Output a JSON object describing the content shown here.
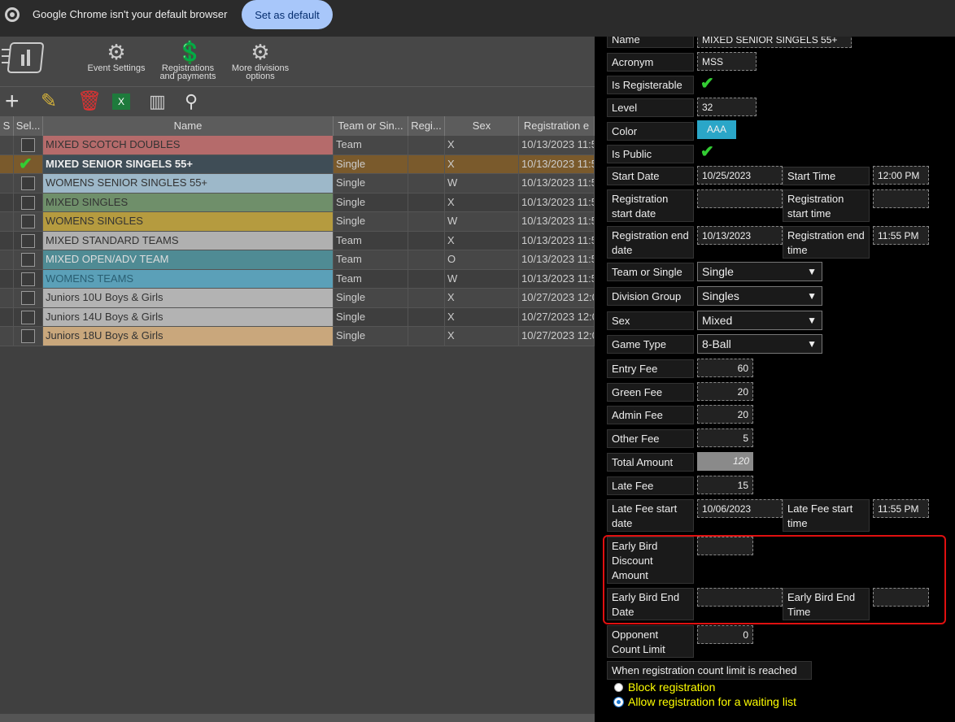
{
  "chrome": {
    "message": "Google Chrome isn't your default browser",
    "button": "Set as default"
  },
  "toolbar": {
    "event_settings": "Event Settings",
    "registrations_l1": "Registrations",
    "registrations_l2": "and payments",
    "more_l1": "More divisions",
    "more_l2": "options"
  },
  "grid": {
    "headers": [
      "Sel...",
      "Name",
      "Team or Sin...",
      "Regi...",
      "Sex",
      "Registration e"
    ],
    "rows": [
      {
        "name": "MIXED SCOTCH DOUBLES",
        "type": "Team",
        "sex": "X",
        "date": "10/13/2023 11:5",
        "color": "#b56b6b",
        "checked": false
      },
      {
        "name": "MIXED SENIOR SINGELS 55+",
        "type": "Single",
        "sex": "X",
        "date": "10/13/2023 11:5",
        "color": "#3f4d56",
        "checked": true
      },
      {
        "name": "WOMENS SENIOR SINGLES 55+",
        "type": "Single",
        "sex": "W",
        "date": "10/13/2023 11:5",
        "color": "#9db8c9",
        "checked": false
      },
      {
        "name": "MIXED SINGLES",
        "type": "Single",
        "sex": "X",
        "date": "10/13/2023 11:5",
        "color": "#6f8f6a",
        "checked": false
      },
      {
        "name": "WOMENS SINGLES",
        "type": "Single",
        "sex": "W",
        "date": "10/13/2023 11:5",
        "color": "#b59b3f",
        "checked": false
      },
      {
        "name": "MIXED STANDARD TEAMS",
        "type": "Team",
        "sex": "X",
        "date": "10/13/2023 11:5",
        "color": "#b0b0b0",
        "checked": false
      },
      {
        "name": "MIXED OPEN/ADV TEAM",
        "type": "Team",
        "sex": "O",
        "date": "10/13/2023 11:5",
        "color": "#4f8b94",
        "checked": false
      },
      {
        "name": "WOMENS TEAMS",
        "type": "Team",
        "sex": "W",
        "date": "10/13/2023 11:5",
        "color": "#5ba0b8",
        "checked": false
      },
      {
        "name": "Juniors 10U Boys & Girls",
        "type": "Single",
        "sex": "X",
        "date": "10/27/2023 12:0",
        "color": "#b3b3b3",
        "checked": false
      },
      {
        "name": "Juniors 14U Boys & Girls",
        "type": "Single",
        "sex": "X",
        "date": "10/27/2023 12:0",
        "color": "#b3b3b3",
        "checked": false
      },
      {
        "name": "Juniors 18U Boys & Girls",
        "type": "Single",
        "sex": "X",
        "date": "10/27/2023 12:0",
        "color": "#c9a77c",
        "checked": false
      }
    ]
  },
  "form": {
    "name_label": "Name",
    "name_value": "MIXED SENIOR SINGELS 55+",
    "acronym_label": "Acronym",
    "acronym_value": "MSS",
    "registerable_label": "Is Registerable",
    "level_label": "Level",
    "level_value": "32",
    "color_label": "Color",
    "color_value": "AAA",
    "public_label": "Is Public",
    "start_date_label": "Start Date",
    "start_date_value": "10/25/2023",
    "start_time_label": "Start Time",
    "start_time_value": "12:00 PM",
    "reg_start_date_label": "Registration start date",
    "reg_start_time_label": "Registration start time",
    "reg_end_date_label": "Registration end date",
    "reg_end_date_value": "10/13/2023",
    "reg_end_time_label": "Registration end time",
    "reg_end_time_value": "11:55 PM",
    "team_single_label": "Team or Single",
    "team_single_value": "Single",
    "division_group_label": "Division Group",
    "division_group_value": "Singles",
    "sex_label": "Sex",
    "sex_value": "Mixed",
    "game_type_label": "Game Type",
    "game_type_value": "8-Ball",
    "entry_fee_label": "Entry Fee",
    "entry_fee_value": "60",
    "green_fee_label": "Green Fee",
    "green_fee_value": "20",
    "admin_fee_label": "Admin Fee",
    "admin_fee_value": "20",
    "other_fee_label": "Other Fee",
    "other_fee_value": "5",
    "total_label": "Total Amount",
    "total_value": "120",
    "late_fee_label": "Late Fee",
    "late_fee_value": "15",
    "late_start_date_label": "Late Fee start date",
    "late_start_date_value": "10/06/2023",
    "late_start_time_label": "Late Fee start time",
    "late_start_time_value": "11:55 PM",
    "early_amount_label": "Early Bird Discount Amount",
    "early_end_date_label": "Early Bird End Date",
    "early_end_time_label": "Early Bird End Time",
    "opponent_label": "Opponent Count Limit",
    "opponent_value": "0",
    "limit_label": "When registration count limit is reached",
    "radio_block": "Block registration",
    "radio_wait": "Allow registration for a waiting list"
  }
}
